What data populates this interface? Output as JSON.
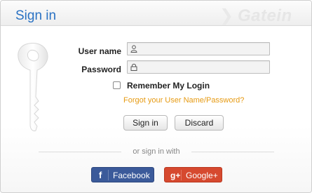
{
  "header": {
    "title": "Sign in",
    "brand_watermark": "Gatein",
    "brand_icon": "gatein-logo-icon"
  },
  "form": {
    "username_label": "User name",
    "username_value": "",
    "username_icon": "user-icon",
    "password_label": "Password",
    "password_value": "",
    "password_icon": "lock-icon",
    "remember_label": "Remember My Login",
    "remember_checked": false,
    "forgot_link": "Forgot your User Name/Password?"
  },
  "actions": {
    "signin_label": "Sign in",
    "discard_label": "Discard"
  },
  "social": {
    "divider_text": "or sign in with",
    "facebook_label": "Facebook",
    "facebook_icon_text": "f",
    "google_label": "Google+",
    "google_icon_text": "g+"
  },
  "colors": {
    "title": "#2a72c3",
    "link": "#e69a12",
    "facebook": "#3b5a9a",
    "google": "#d6492f"
  }
}
